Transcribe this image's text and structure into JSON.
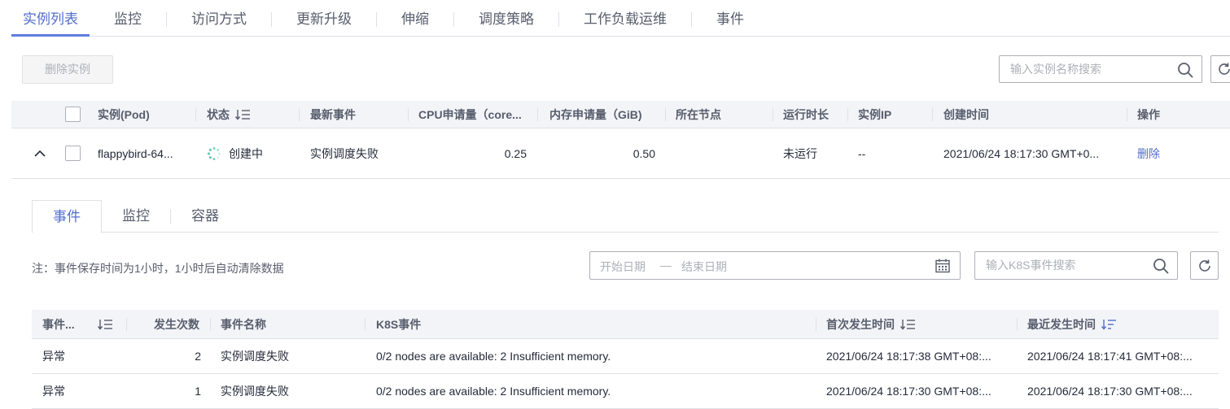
{
  "top_tabs": [
    "实例列表",
    "监控",
    "访问方式",
    "更新升级",
    "伸缩",
    "调度策略",
    "工作负载运维",
    "事件"
  ],
  "toolbar": {
    "delete_label": "删除实例",
    "search_placeholder": "输入实例名称搜索"
  },
  "main_table": {
    "headers": [
      "实例(Pod)",
      "状态",
      "最新事件",
      "CPU申请量（core...",
      "内存申请量（GiB)",
      "所在节点",
      "运行时长",
      "实例IP",
      "创建时间",
      "操作"
    ],
    "row": {
      "name": "flappybird-64...",
      "status": "创建中",
      "latest_event": "实例调度失败",
      "cpu": "0.25",
      "memory": "0.50",
      "node": "",
      "runtime": "未运行",
      "ip": "--",
      "created": "2021/06/24 18:17:30 GMT+0...",
      "action": "删除"
    }
  },
  "sub_tabs": [
    "事件",
    "监控",
    "容器"
  ],
  "events": {
    "note": "注：事件保存时间为1小时，1小时后自动清除数据",
    "start_placeholder": "开始日期",
    "range_sep": "—",
    "end_placeholder": "结束日期",
    "search_placeholder": "输入K8S事件搜索",
    "headers": [
      "事件...",
      "发生次数",
      "事件名称",
      "K8S事件",
      "首次发生时间",
      "最近发生时间"
    ],
    "rows": [
      {
        "type": "异常",
        "count": "2",
        "name": "实例调度失败",
        "k8s": "0/2 nodes are available: 2 Insufficient memory.",
        "first": "2021/06/24 18:17:38 GMT+08:...",
        "last": "2021/06/24 18:17:41 GMT+08:..."
      },
      {
        "type": "异常",
        "count": "1",
        "name": "实例调度失败",
        "k8s": "0/2 nodes are available: 2 Insufficient memory.",
        "first": "2021/06/24 18:17:30 GMT+08:...",
        "last": "2021/06/24 18:17:30 GMT+08:..."
      }
    ]
  },
  "colors": {
    "accent": "#526ecc",
    "border": "#dfe1e6",
    "header_bg": "#f3f4f8",
    "text": "#252b3a",
    "muted": "#adb0b8"
  }
}
